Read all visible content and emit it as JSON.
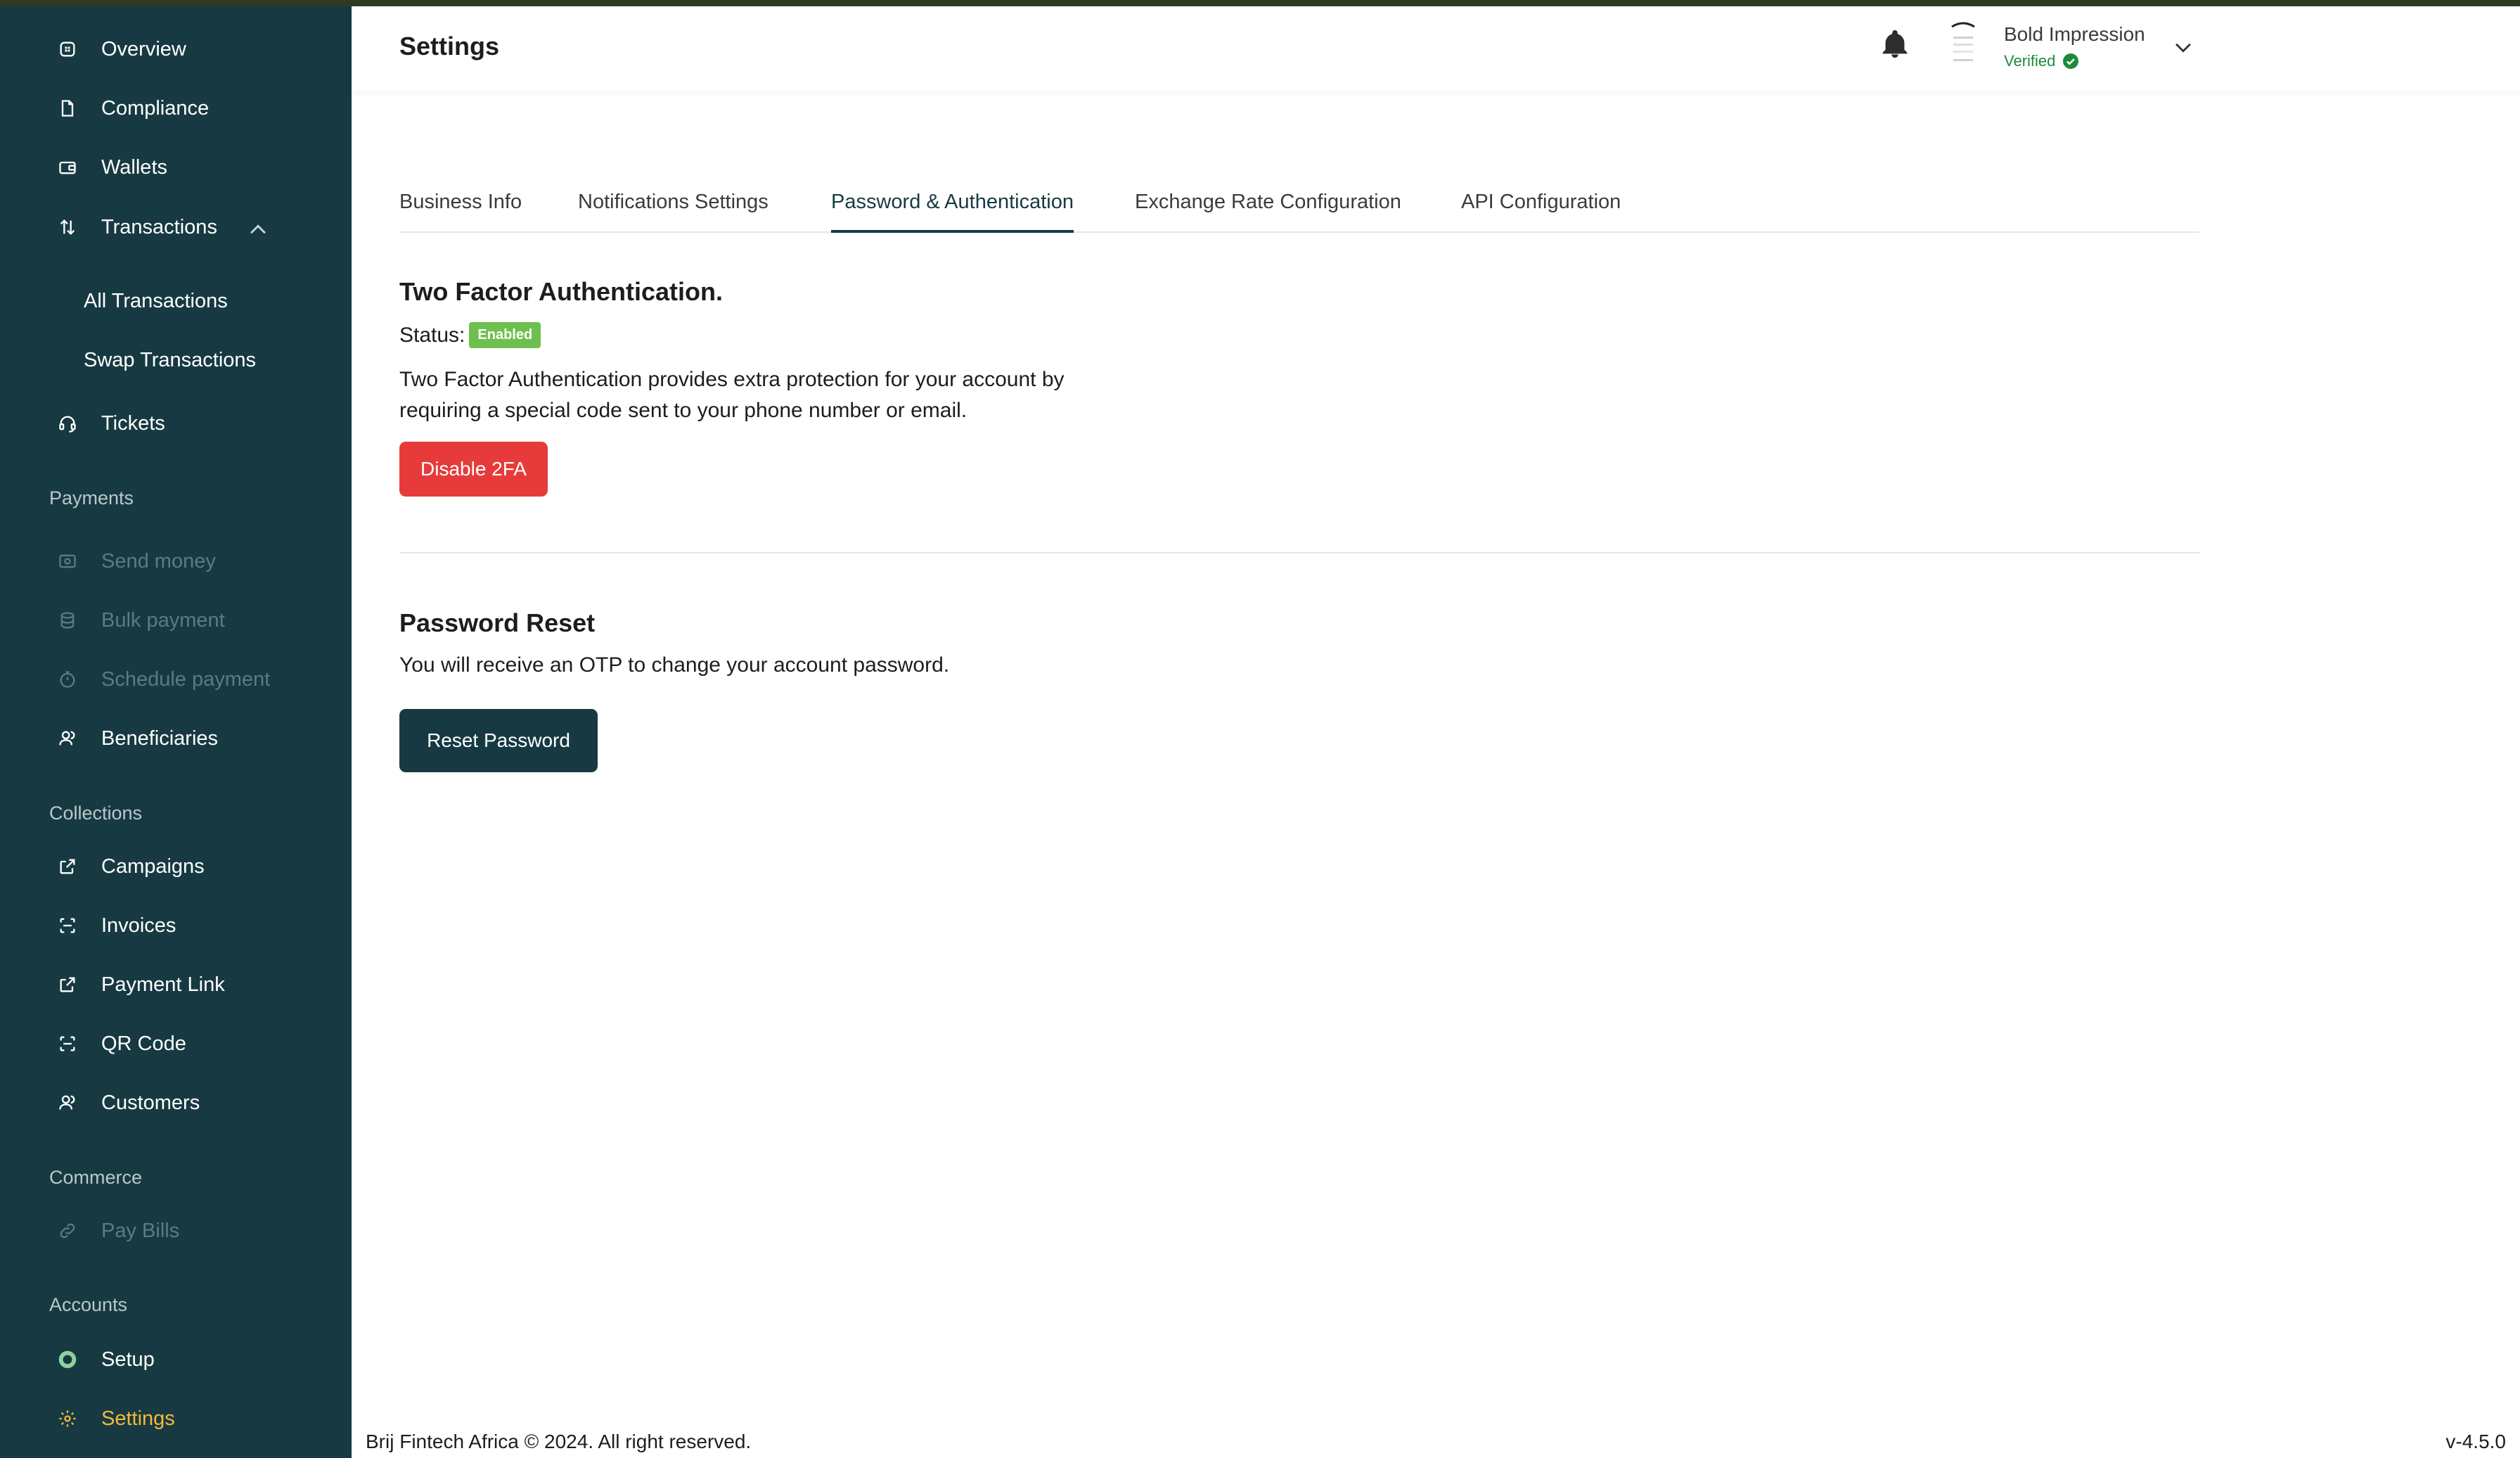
{
  "header": {
    "title": "Settings",
    "user_name": "Bold Impression",
    "verified_label": "Verified"
  },
  "sidebar": {
    "items": [
      {
        "label": "Overview",
        "icon": "grid-icon"
      },
      {
        "label": "Compliance",
        "icon": "document-icon"
      },
      {
        "label": "Wallets",
        "icon": "wallet-icon"
      },
      {
        "label": "Transactions",
        "icon": "arrows-updown-icon"
      },
      {
        "label": "All Transactions"
      },
      {
        "label": "Swap Transactions"
      },
      {
        "label": "Tickets",
        "icon": "headset-icon"
      }
    ],
    "sections": {
      "payments": "Payments",
      "collections": "Collections",
      "commerce": "Commerce",
      "accounts": "Accounts"
    },
    "payments": [
      {
        "label": "Send money",
        "icon": "send-money-icon"
      },
      {
        "label": "Bulk payment",
        "icon": "database-icon"
      },
      {
        "label": "Schedule payment",
        "icon": "timer-icon"
      },
      {
        "label": "Beneficiaries",
        "icon": "users-icon"
      }
    ],
    "collections": [
      {
        "label": "Campaigns",
        "icon": "external-link-icon"
      },
      {
        "label": "Invoices",
        "icon": "scan-icon"
      },
      {
        "label": "Payment Link",
        "icon": "external-link-icon"
      },
      {
        "label": "QR Code",
        "icon": "scan-icon"
      },
      {
        "label": "Customers",
        "icon": "users-icon"
      }
    ],
    "commerce": [
      {
        "label": "Pay Bills",
        "icon": "link-icon"
      }
    ],
    "accounts": [
      {
        "label": "Setup",
        "icon": "progress-ring-icon"
      },
      {
        "label": "Settings",
        "icon": "gear-icon"
      }
    ]
  },
  "tabs": [
    {
      "label": "Business Info"
    },
    {
      "label": "Notifications Settings"
    },
    {
      "label": "Password & Authentication"
    },
    {
      "label": "Exchange Rate Configuration"
    },
    {
      "label": "API Configuration"
    }
  ],
  "two_factor": {
    "title": "Two Factor Authentication.",
    "status_label": "Status:",
    "status_value": "Enabled",
    "description_line1": "Two Factor Authentication provides extra protection for your account by",
    "description_line2": "requiring a special code sent to your phone number or email.",
    "button_label": "Disable 2FA"
  },
  "password_reset": {
    "title": "Password Reset",
    "description": "You will receive an OTP to change your account password.",
    "button_label": "Reset Password"
  },
  "footer": {
    "copyright": "Brij Fintech Africa © 2024. All right reserved.",
    "version": "v-4.5.0"
  },
  "colors": {
    "sidebar_bg": "#173a42",
    "accent_active": "#f5b73b",
    "danger": "#e73b3b",
    "success": "#6fbf4f",
    "verified": "#1e8a3c"
  }
}
